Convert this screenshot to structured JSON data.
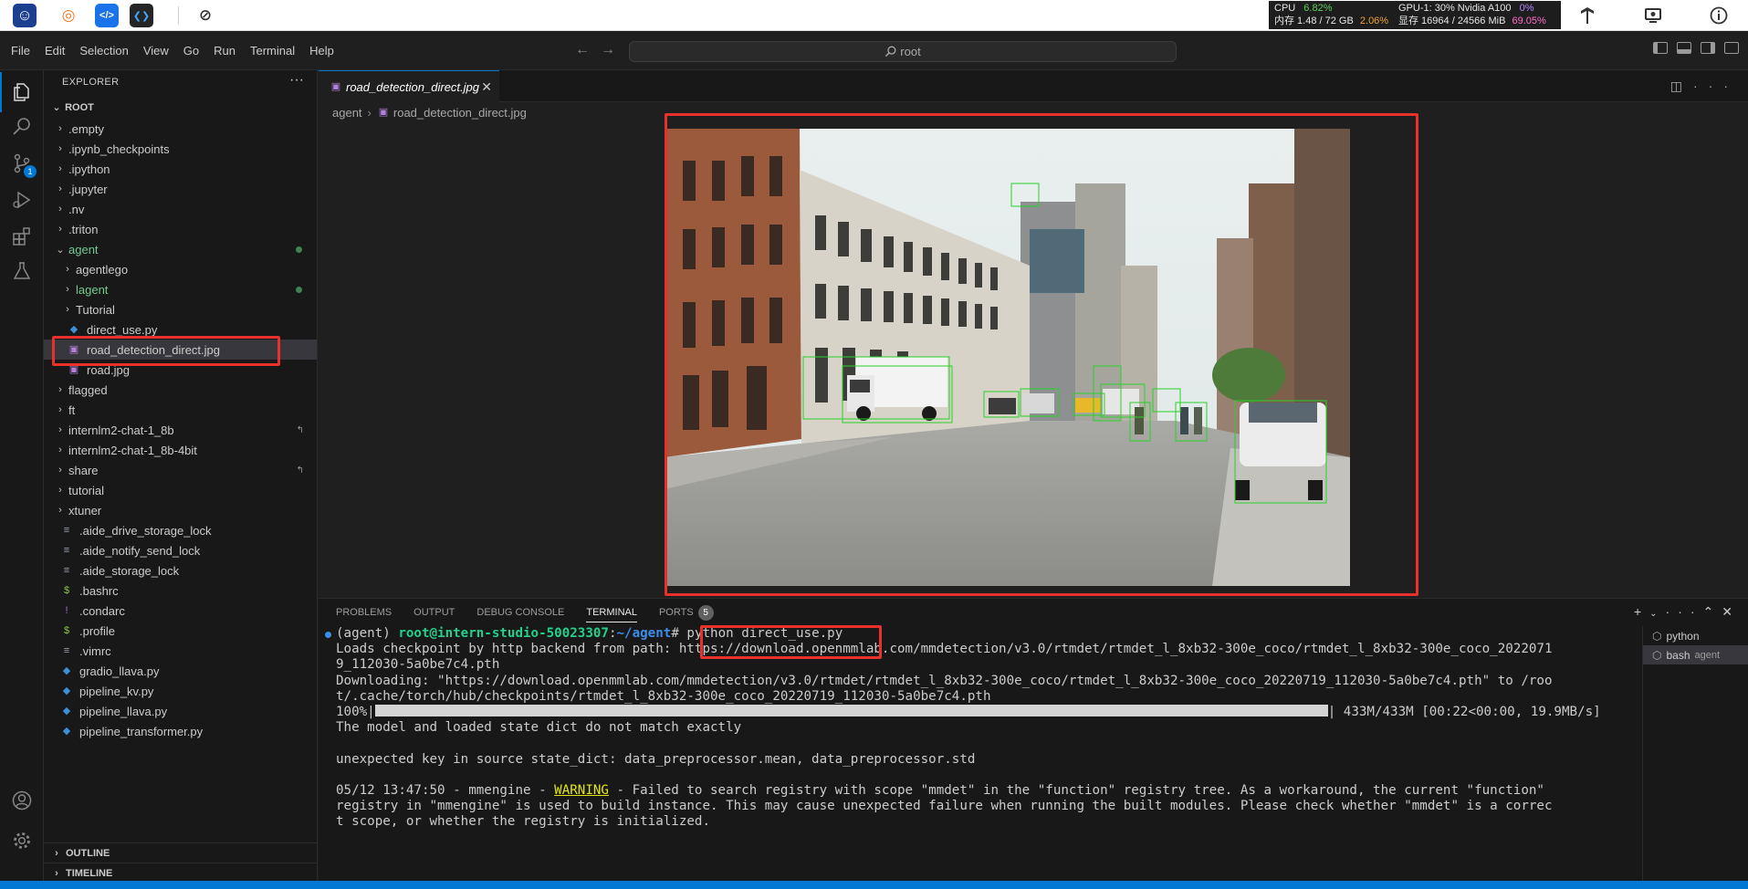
{
  "os_bar": {
    "apps": [
      {
        "name": "intern-logo-icon",
        "glyph": "☺",
        "bg": "#1c3f8f",
        "fg": "#ffffff"
      },
      {
        "name": "jupyter-icon",
        "glyph": "◎",
        "bg": "#ffffff",
        "fg": "#f37726"
      },
      {
        "name": "code-server-icon",
        "glyph": "</>",
        "bg": "#1a73e8",
        "fg": "#ffffff"
      },
      {
        "name": "vscode-icon",
        "glyph": "❮❯",
        "bg": "#252526",
        "fg": "#3ea6ff"
      },
      {
        "name": "compass-icon",
        "glyph": "⊘",
        "bg": "#ffffff",
        "fg": "#333333"
      }
    ],
    "monitor": {
      "cpu_label": "CPU",
      "cpu_value": "6.82%",
      "mem_label": "内存 1.48 / 72 GB",
      "mem_value": "2.06%",
      "gpu_label": "GPU-1: 30% Nvidia A100",
      "gpu_value": "0%",
      "vram_label": "显存 16964 / 24566 MiB",
      "vram_value": "69.05%"
    },
    "right_icons": [
      "tensorflow-icon",
      "screen-icon",
      "info-icon"
    ]
  },
  "menu": {
    "items": [
      "File",
      "Edit",
      "Selection",
      "View",
      "Go",
      "Run",
      "Terminal",
      "Help"
    ],
    "search_text": "root"
  },
  "sidebar": {
    "title": "EXPLORER",
    "root_label": "ROOT",
    "items": [
      {
        "label": ".empty",
        "type": "folder",
        "depth": 0
      },
      {
        "label": ".ipynb_checkpoints",
        "type": "folder",
        "depth": 0
      },
      {
        "label": ".ipython",
        "type": "folder",
        "depth": 0
      },
      {
        "label": ".jupyter",
        "type": "folder",
        "depth": 0
      },
      {
        "label": ".nv",
        "type": "folder",
        "depth": 0
      },
      {
        "label": ".triton",
        "type": "folder",
        "depth": 0
      },
      {
        "label": "agent",
        "type": "folder-open",
        "depth": 0,
        "git": true
      },
      {
        "label": "agentlego",
        "type": "folder",
        "depth": 1
      },
      {
        "label": "lagent",
        "type": "folder",
        "depth": 1,
        "git": true
      },
      {
        "label": "Tutorial",
        "type": "folder",
        "depth": 1
      },
      {
        "label": "direct_use.py",
        "type": "py",
        "depth": 1
      },
      {
        "label": "road_detection_direct.jpg",
        "type": "img",
        "depth": 1,
        "selected": true
      },
      {
        "label": "road.jpg",
        "type": "img",
        "depth": 1
      },
      {
        "label": "flagged",
        "type": "folder",
        "depth": 0
      },
      {
        "label": "ft",
        "type": "folder",
        "depth": 0
      },
      {
        "label": "internlm2-chat-1_8b",
        "type": "folder",
        "depth": 0,
        "link": true
      },
      {
        "label": "internlm2-chat-1_8b-4bit",
        "type": "folder",
        "depth": 0
      },
      {
        "label": "share",
        "type": "folder",
        "depth": 0,
        "link": true
      },
      {
        "label": "tutorial",
        "type": "folder",
        "depth": 0
      },
      {
        "label": "xtuner",
        "type": "folder",
        "depth": 0
      },
      {
        "label": ".aide_drive_storage_lock",
        "type": "lock",
        "depth": 0
      },
      {
        "label": ".aide_notify_send_lock",
        "type": "lock",
        "depth": 0
      },
      {
        "label": ".aide_storage_lock",
        "type": "lock",
        "depth": 0
      },
      {
        "label": ".bashrc",
        "type": "shell",
        "depth": 0
      },
      {
        "label": ".condarc",
        "type": "yaml",
        "depth": 0
      },
      {
        "label": ".profile",
        "type": "shell",
        "depth": 0
      },
      {
        "label": ".vimrc",
        "type": "lock",
        "depth": 0
      },
      {
        "label": "gradio_llava.py",
        "type": "py",
        "depth": 0
      },
      {
        "label": "pipeline_kv.py",
        "type": "py",
        "depth": 0
      },
      {
        "label": "pipeline_llava.py",
        "type": "py",
        "depth": 0
      },
      {
        "label": "pipeline_transformer.py",
        "type": "py",
        "depth": 0
      }
    ],
    "outline_label": "OUTLINE",
    "timeline_label": "TIMELINE",
    "scm_badge": "1"
  },
  "editor": {
    "tab_label": "road_detection_direct.jpg",
    "breadcrumb_folder": "agent",
    "breadcrumb_file": "road_detection_direct.jpg"
  },
  "panel": {
    "tabs": [
      "PROBLEMS",
      "OUTPUT",
      "DEBUG CONSOLE",
      "TERMINAL",
      "PORTS"
    ],
    "active_tab": "TERMINAL",
    "ports_count": "5",
    "terminal": {
      "env": "(agent) ",
      "user_host": "root@intern-studio-50023307",
      "path": "~/agent",
      "command": "python direct_use.py",
      "lines": [
        "Loads checkpoint by http backend from path: https://download.openmmlab.com/mmdetection/v3.0/rtmdet/rtmdet_l_8xb32-300e_coco/rtmdet_l_8xb32-300e_coco_2022071",
        "9_112030-5a0be7c4.pth",
        "Downloading: \"https://download.openmmlab.com/mmdetection/v3.0/rtmdet/rtmdet_l_8xb32-300e_coco/rtmdet_l_8xb32-300e_coco_20220719_112030-5a0be7c4.pth\" to /roo",
        "t/.cache/torch/hub/checkpoints/rtmdet_l_8xb32-300e_coco_20220719_112030-5a0be7c4.pth"
      ],
      "progress_pct": "100%|",
      "progress_tail": "| 433M/433M [00:22<00:00, 19.9MB/s]",
      "line_mismatch": "The model and loaded state dict do not match exactly",
      "line_unexpected": "unexpected key in source state_dict: data_preprocessor.mean, data_preprocessor.std",
      "warn_prefix": "05/12 13:47:50 - mmengine - ",
      "warn_word": "WARNING",
      "warn_lines": [
        " - Failed to search registry with scope \"mmdet\" in the \"function\" registry tree. As a workaround, the current \"function\"",
        "registry in \"mmengine\" is used to build instance. This may cause unexpected failure when running the built modules. Please check whether \"mmdet\" is a correc",
        "t scope, or whether the registry is initialized."
      ]
    },
    "terminals": [
      {
        "label": "python",
        "sub": ""
      },
      {
        "label": "bash",
        "sub": "agent"
      }
    ]
  }
}
